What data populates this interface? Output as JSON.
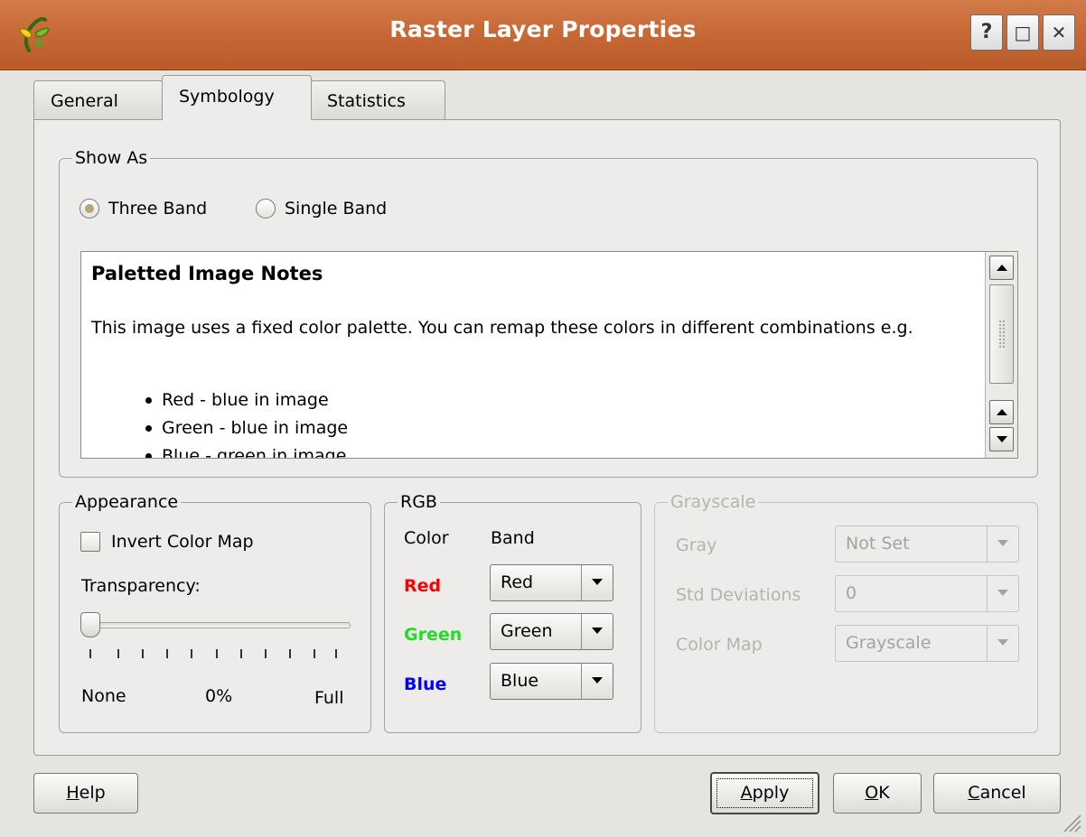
{
  "window": {
    "title": "Raster Layer Properties",
    "help_glyph": "?",
    "maximize_glyph": "□",
    "close_glyph": "✕",
    "titlebar_color": "#c86a37"
  },
  "tabs": [
    {
      "label": "General",
      "active": false
    },
    {
      "label": "Symbology",
      "active": true
    },
    {
      "label": "Statistics",
      "active": false
    }
  ],
  "show_as": {
    "title": "Show As",
    "three_band_label": "Three Band",
    "single_band_label": "Single Band",
    "selected": "Three Band"
  },
  "notes": {
    "heading": "Paletted Image Notes",
    "paragraph": "This image uses a fixed color palette. You can remap these colors in different combinations e.g.",
    "items": [
      "Red - blue in image",
      "Green - blue in image",
      "Blue - green in image"
    ]
  },
  "appearance": {
    "title": "Appearance",
    "invert_label": "Invert Color Map",
    "invert_checked": false,
    "transparency_label": "Transparency:",
    "transparency_value": 0,
    "none_label": "None",
    "percent_label": "0%",
    "full_label": "Full"
  },
  "rgb": {
    "title": "RGB",
    "color_header": "Color",
    "band_header": "Band",
    "red_label": "Red",
    "green_label": "Green",
    "blue_label": "Blue",
    "red_value": "Red",
    "green_value": "Green",
    "blue_value": "Blue",
    "red_color": "#ff0000",
    "green_color": "#22dd22",
    "blue_color": "#0000ff"
  },
  "grayscale": {
    "title": "Grayscale",
    "enabled": false,
    "gray_label": "Gray",
    "gray_value": "Not Set",
    "std_label": "Std Deviations",
    "std_value": "0",
    "colormap_label": "Color Map",
    "colormap_value": "Grayscale"
  },
  "buttons": {
    "help_rest": "elp",
    "help_mnemonic": "H",
    "apply_rest": "pply",
    "apply_mnemonic": "A",
    "ok_rest": "K",
    "ok_mnemonic": "O",
    "cancel_rest": "ancel",
    "cancel_mnemonic": "C"
  }
}
